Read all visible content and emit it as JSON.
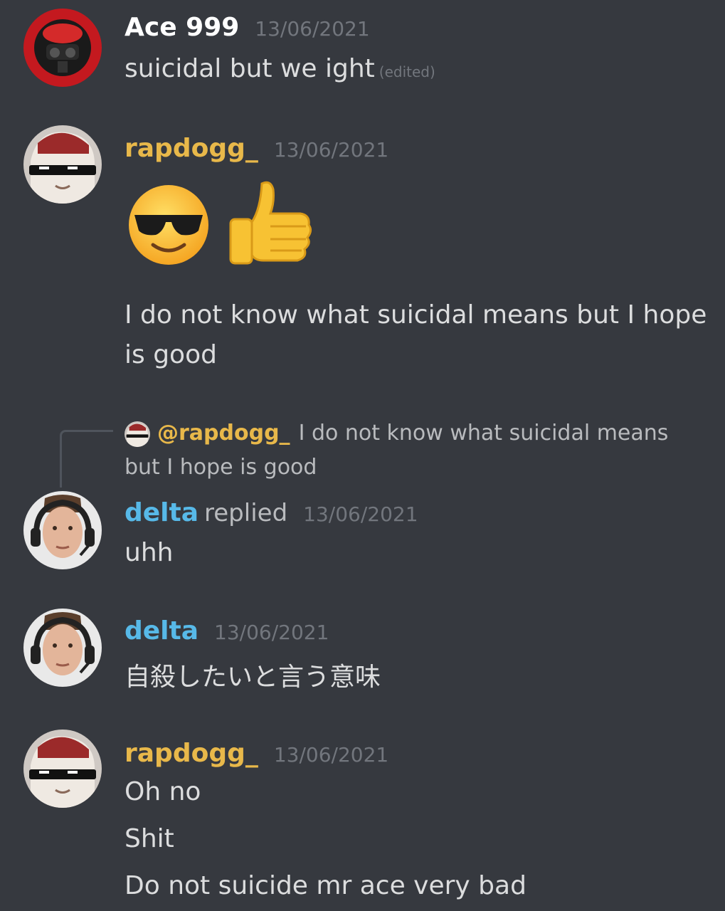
{
  "messages": [
    {
      "author": "Ace 999",
      "timestamp": "13/06/2021",
      "lines": [
        "suicidal but we ight"
      ],
      "edited_label": "(edited)"
    },
    {
      "author": "rapdogg_",
      "timestamp": "13/06/2021",
      "emojis": [
        "smiling-face-with-sunglasses",
        "thumbs-up"
      ],
      "lines": [
        "I do not know what suicidal means but I hope",
        "is good"
      ]
    },
    {
      "author": "delta",
      "replied_label": "replied",
      "timestamp": "13/06/2021",
      "reply_to": {
        "mention": "@rapdogg_",
        "text": "I do not know what suicidal means but I hope is good"
      },
      "lines": [
        "uhh"
      ]
    },
    {
      "author": "delta",
      "timestamp": "13/06/2021",
      "lines": [
        "自殺したいと言う意味"
      ]
    },
    {
      "author": "rapdogg_",
      "timestamp": "13/06/2021",
      "lines": [
        "Oh no",
        "Shit",
        "Do not suicide mr ace very bad"
      ]
    }
  ],
  "colors": {
    "background": "#36393f",
    "ace_name": "#ffffff",
    "rapdogg_name": "#e8b84a",
    "delta_name": "#57b9e8",
    "timestamp": "#72767d"
  }
}
